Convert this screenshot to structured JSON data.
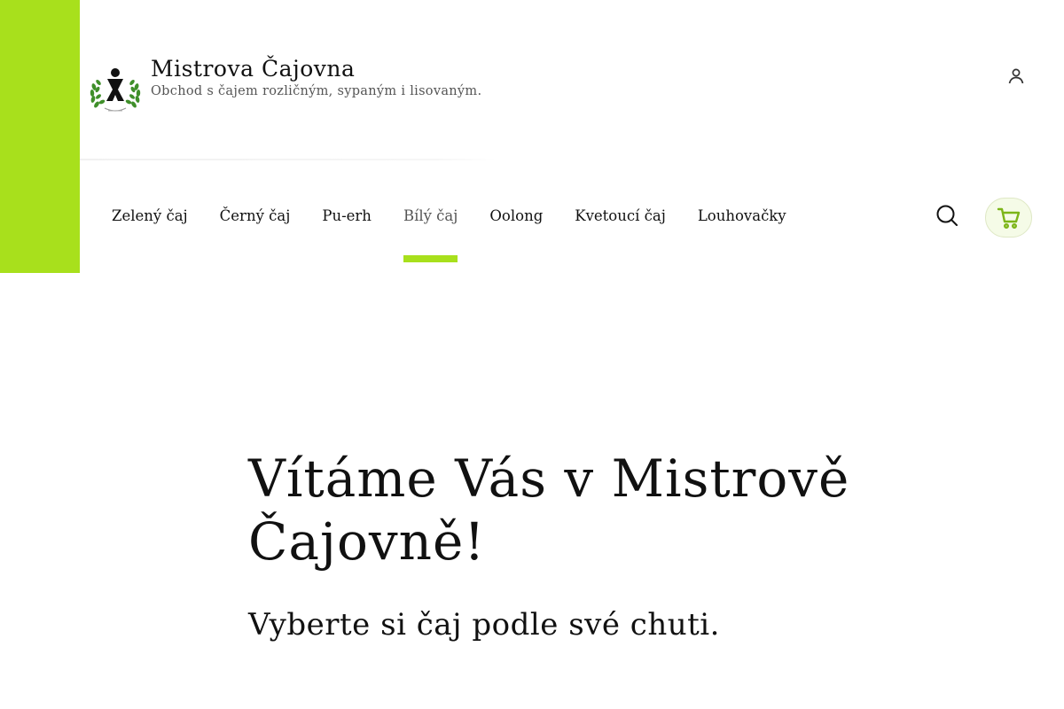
{
  "site": {
    "title": "Mistrova Čajovna",
    "tagline": "Obchod s čajem rozličným, sypaným i lisovaným."
  },
  "nav": {
    "items": [
      {
        "label": "Zelený čaj"
      },
      {
        "label": "Černý čaj"
      },
      {
        "label": "Pu-erh"
      },
      {
        "label": "Bílý čaj",
        "active": true
      },
      {
        "label": "Oolong"
      },
      {
        "label": "Kvetoucí čaj"
      },
      {
        "label": "Louhovačky"
      }
    ]
  },
  "icons": {
    "logo": "laurel-meeple-logo",
    "account": "user-icon",
    "search": "search-icon",
    "cart": "cart-icon"
  },
  "hero": {
    "title": "Vítáme Vás v Mistrově Čajovně!",
    "subtitle": "Vyberte si čaj podle své chuti."
  },
  "colors": {
    "accent": "#a8e01c",
    "cart_icon": "#7cb518",
    "logo_leaves": "#3f8f2a"
  }
}
